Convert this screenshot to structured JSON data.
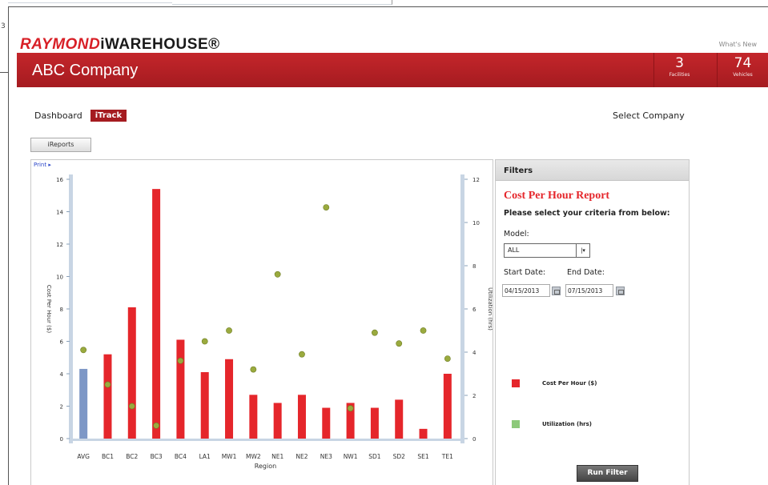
{
  "edge_number": "3",
  "header": {
    "logo_brand": "RAYMOND",
    "logo_product": "iWAREHOUSE®",
    "whats_new": "What's New",
    "company_name": "ABC Company",
    "stats": [
      {
        "value": "3",
        "label": "Facilities"
      },
      {
        "value": "74",
        "label": "Vehicles"
      }
    ]
  },
  "nav": {
    "dashboard": "Dashboard",
    "itrack": "iTrack",
    "select_company": "Select Company"
  },
  "ireports_button": "iReports",
  "print_link": "Print ▸",
  "filters": {
    "header": "Filters",
    "report_title": "Cost Per Hour Report",
    "criteria_prompt": "Please select your criteria from below:",
    "model_label": "Model:",
    "model_value": "ALL",
    "start_date_label": "Start Date:",
    "end_date_label": "End Date:",
    "start_date": "04/15/2013",
    "end_date": "07/15/2013",
    "legend_cost": "Cost Per Hour ($)",
    "legend_util": "Utilization (hrs)",
    "run_filter": "Run Filter"
  },
  "colors": {
    "brand_red": "#c4262b",
    "bar_red": "#e5262b",
    "bar_avg": "#7d97c6",
    "dot_green": "#9aaa3e",
    "legend_util": "#8cc97a"
  },
  "chart_data": {
    "type": "bar",
    "xlabel": "Region",
    "ylabel": "Cost Per Hour ($)",
    "y2label": "Utilization (hrs)",
    "categories": [
      "AVG",
      "BC1",
      "BC2",
      "BC3",
      "BC4",
      "LA1",
      "MW1",
      "MW2",
      "NE1",
      "NE2",
      "NE3",
      "NW1",
      "SD1",
      "SD2",
      "SE1",
      "TE1"
    ],
    "ylim": [
      0,
      16
    ],
    "y2lim": [
      0,
      12
    ],
    "yticks": [
      0,
      2,
      4,
      6,
      8,
      10,
      12,
      14,
      16
    ],
    "y2ticks": [
      0,
      2,
      4,
      6,
      8,
      10,
      12
    ],
    "series": [
      {
        "name": "Cost Per Hour ($)",
        "kind": "bar",
        "values": [
          4.3,
          5.2,
          8.1,
          15.4,
          6.1,
          4.1,
          4.9,
          2.7,
          2.2,
          2.7,
          1.9,
          2.2,
          1.9,
          2.4,
          0.6,
          4.0
        ]
      },
      {
        "name": "Utilization (hrs)",
        "kind": "scatter",
        "axis": "y2",
        "values": [
          4.1,
          2.5,
          1.5,
          0.6,
          3.6,
          4.5,
          5.0,
          3.2,
          7.6,
          3.9,
          10.7,
          1.4,
          4.9,
          4.4,
          5.0,
          3.7
        ]
      }
    ]
  }
}
